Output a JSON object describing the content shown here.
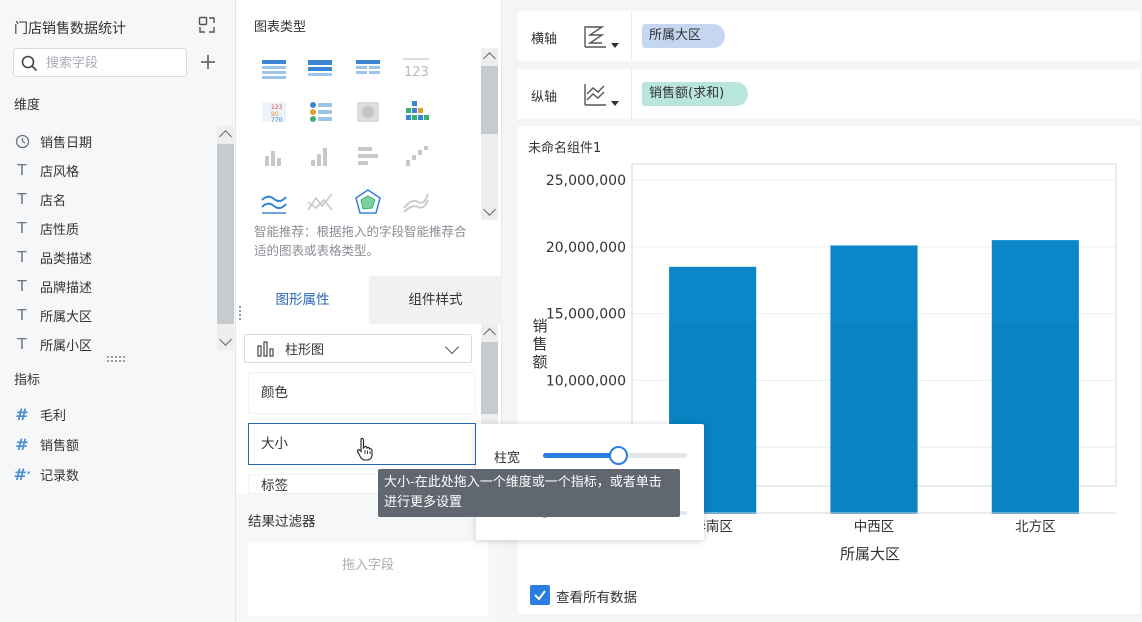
{
  "left": {
    "title": "门店销售数据统计",
    "search_placeholder": "搜索字段",
    "dimension_title": "维度",
    "dimensions": [
      {
        "label": "销售日期",
        "icon": "clock-icon"
      },
      {
        "label": "店风格",
        "icon": "text-field-icon"
      },
      {
        "label": "店名",
        "icon": "text-field-icon"
      },
      {
        "label": "店性质",
        "icon": "text-field-icon"
      },
      {
        "label": "品类描述",
        "icon": "text-field-icon"
      },
      {
        "label": "品牌描述",
        "icon": "text-field-icon"
      },
      {
        "label": "所属大区",
        "icon": "text-field-icon"
      },
      {
        "label": "所属小区",
        "icon": "text-field-icon"
      }
    ],
    "metric_title": "指标",
    "metrics": [
      {
        "label": "毛利",
        "icon": "number-field-icon"
      },
      {
        "label": "销售额",
        "icon": "number-field-icon"
      },
      {
        "label": "记录数",
        "icon": "record-count-icon"
      }
    ]
  },
  "mid": {
    "chart_type_title": "图表类型",
    "recommend_text": "智能推荐：根据拖入的字段智能推荐合适的图表或表格类型。",
    "tabs": {
      "active": "图形属性",
      "other": "组件样式"
    },
    "chart_type_selected": "柱形图",
    "props": {
      "color": "颜色",
      "size": "大小",
      "label": "标签"
    },
    "filter_title": "结果过滤器",
    "drop_placeholder": "拖入字段"
  },
  "right": {
    "x_axis_label": "横轴",
    "x_field": "所属大区",
    "y_axis_label": "纵轴",
    "y_field": "销售额(求和)",
    "component_title": "未命名组件1",
    "view_all_label": "查看所有数据"
  },
  "popover": {
    "width_label": "柱宽",
    "width_value": 0.53,
    "tooltip": "大小-在此处拖入一个维度或一个指标，或者单击进行更多设置"
  },
  "colors": {
    "accent": "#2a7de1",
    "bar": "#0b87c9",
    "bar_dark": "#0a7ab8",
    "pill_x": "#c5d7f0",
    "pill_y": "#b8e5dc"
  },
  "chart_data": {
    "type": "bar",
    "categories": [
      "华南区",
      "中西区",
      "北方区"
    ],
    "values": [
      18500000,
      20100000,
      20500000
    ],
    "xlabel": "所属大区",
    "ylabel": "销售额",
    "ylim": [
      0,
      25000000
    ],
    "yticks": [
      "25,000,000",
      "20,000,000",
      "15,000,000",
      "10,000,000"
    ],
    "grid": true,
    "legend": "none"
  }
}
